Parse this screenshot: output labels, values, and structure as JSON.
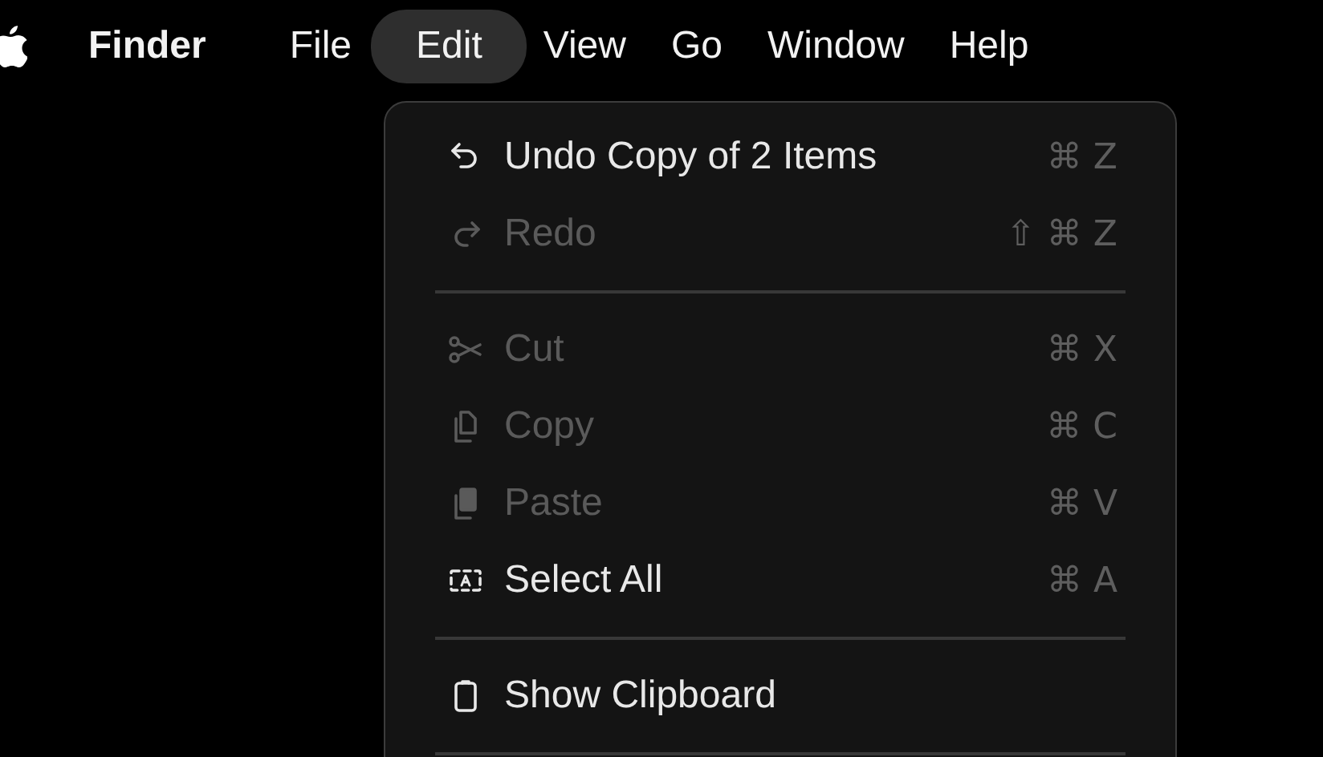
{
  "menu_bar": {
    "app_name": "Finder",
    "menus": [
      {
        "label": "File",
        "selected": false
      },
      {
        "label": "Edit",
        "selected": true
      },
      {
        "label": "View",
        "selected": false
      },
      {
        "label": "Go",
        "selected": false
      },
      {
        "label": "Window",
        "selected": false
      },
      {
        "label": "Help",
        "selected": false
      }
    ]
  },
  "edit_menu": {
    "items": [
      {
        "kind": "item",
        "label": "Undo Copy of 2 Items",
        "shortcut": "⌘ Z",
        "disabled": false
      },
      {
        "kind": "item",
        "label": "Redo",
        "shortcut": "⇧ ⌘ Z",
        "disabled": true
      },
      {
        "kind": "separator"
      },
      {
        "kind": "item",
        "label": "Cut",
        "shortcut": "⌘ X",
        "disabled": true
      },
      {
        "kind": "item",
        "label": "Copy",
        "shortcut": "⌘ C",
        "disabled": true
      },
      {
        "kind": "item",
        "label": "Paste",
        "shortcut": "⌘ V",
        "disabled": true
      },
      {
        "kind": "item",
        "label": "Select All",
        "shortcut": "⌘ A",
        "disabled": false
      },
      {
        "kind": "separator"
      },
      {
        "kind": "item",
        "label": "Show Clipboard",
        "disabled": false
      },
      {
        "kind": "separator"
      }
    ]
  }
}
